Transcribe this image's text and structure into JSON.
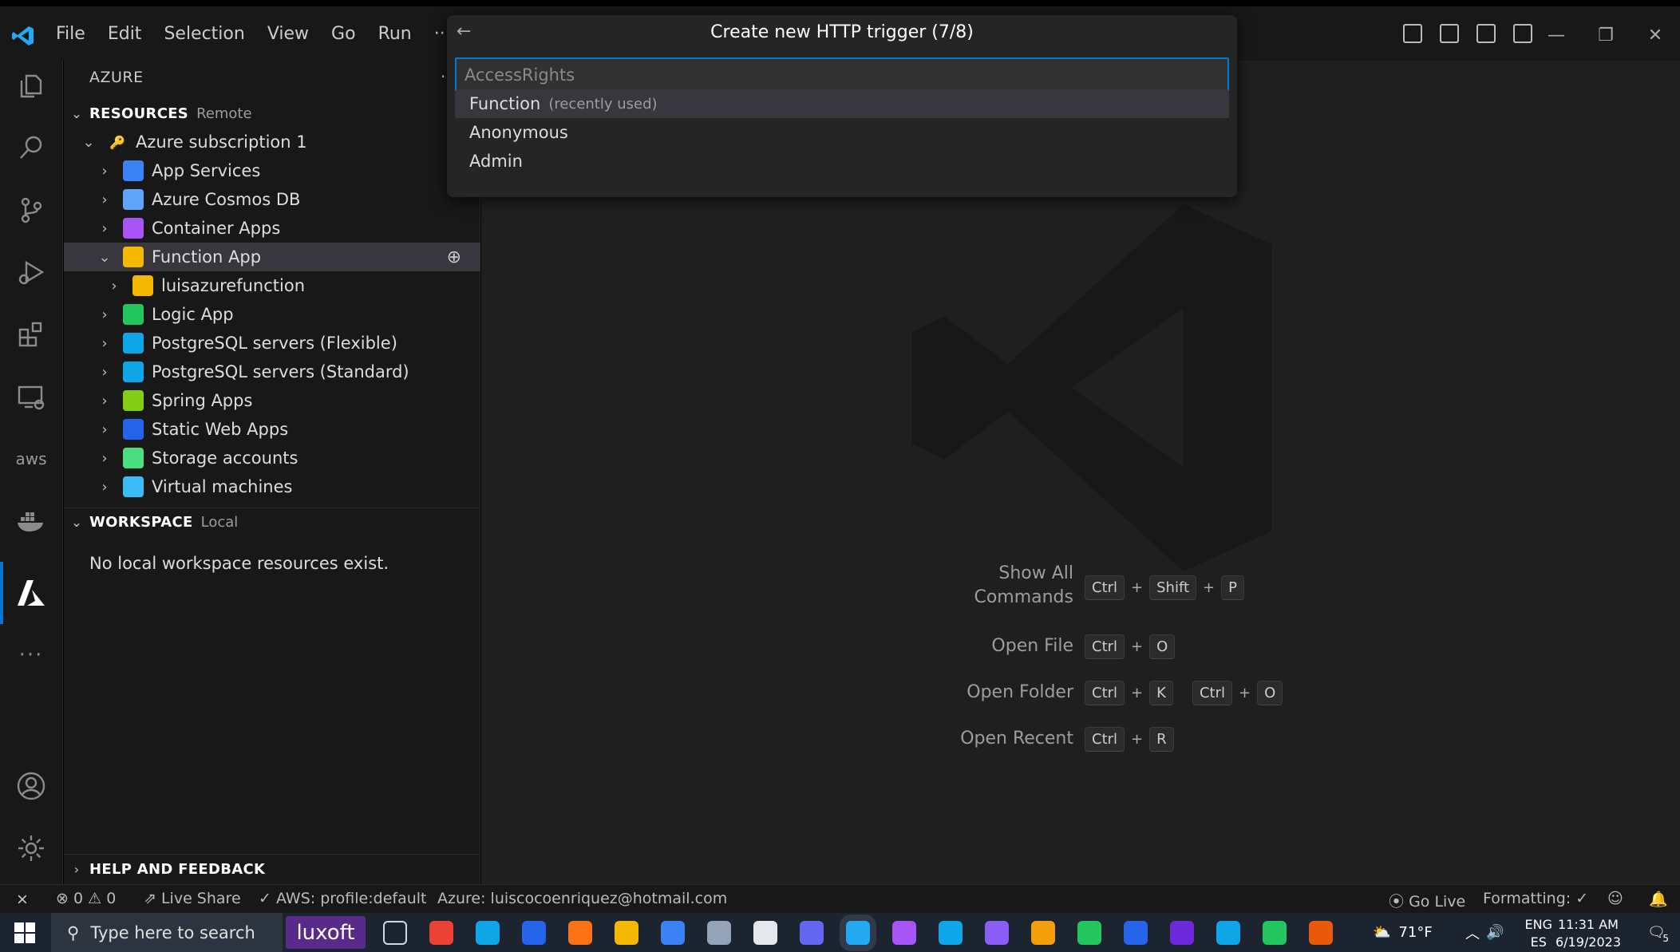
{
  "menu": [
    "File",
    "Edit",
    "Selection",
    "View",
    "Go",
    "Run",
    "···"
  ],
  "quickpick": {
    "title": "Create new HTTP trigger (7/8)",
    "placeholder": "AccessRights",
    "items": [
      {
        "label": "Function",
        "desc": "(recently used)"
      },
      {
        "label": "Anonymous",
        "desc": ""
      },
      {
        "label": "Admin",
        "desc": ""
      }
    ]
  },
  "sidebar": {
    "title": "AZURE",
    "resources": {
      "label": "RESOURCES",
      "sub": "Remote"
    },
    "subscription": "Azure subscription 1",
    "items": [
      {
        "label": "App Services",
        "icon": "app-services-icon",
        "color": "#3b82f6"
      },
      {
        "label": "Azure Cosmos DB",
        "icon": "cosmos-db-icon",
        "color": "#60a5fa"
      },
      {
        "label": "Container Apps",
        "icon": "container-apps-icon",
        "color": "#a855f7"
      },
      {
        "label": "Function App",
        "icon": "function-app-icon",
        "color": "#f5b700"
      },
      {
        "label": "luisazurefunction",
        "icon": "function-icon",
        "color": "#f5b700"
      },
      {
        "label": "Logic App",
        "icon": "logic-app-icon",
        "color": "#22c55e"
      },
      {
        "label": "PostgreSQL servers (Flexible)",
        "icon": "postgresql-icon",
        "color": "#0ea5e9"
      },
      {
        "label": "PostgreSQL servers (Standard)",
        "icon": "postgresql-icon",
        "color": "#0ea5e9"
      },
      {
        "label": "Spring Apps",
        "icon": "spring-apps-icon",
        "color": "#84cc16"
      },
      {
        "label": "Static Web Apps",
        "icon": "static-web-apps-icon",
        "color": "#2563eb"
      },
      {
        "label": "Storage accounts",
        "icon": "storage-icon",
        "color": "#4ade80"
      },
      {
        "label": "Virtual machines",
        "icon": "vm-icon",
        "color": "#38bdf8"
      }
    ],
    "workspace": {
      "label": "WORKSPACE",
      "sub": "Local",
      "empty": "No local workspace resources exist."
    },
    "help": "HELP AND FEEDBACK"
  },
  "shortcuts": [
    {
      "label": "Show All\nCommands",
      "keys": [
        [
          "Ctrl",
          "Shift",
          "P"
        ]
      ]
    },
    {
      "label": "Open File",
      "keys": [
        [
          "Ctrl",
          "O"
        ]
      ]
    },
    {
      "label": "Open Folder",
      "keys": [
        [
          "Ctrl",
          "K"
        ],
        [
          "Ctrl",
          "O"
        ]
      ]
    },
    {
      "label": "Open Recent",
      "keys": [
        [
          "Ctrl",
          "R"
        ]
      ]
    }
  ],
  "status": {
    "errors": "0",
    "warnings": "0",
    "liveshare": "Live Share",
    "aws": "AWS: profile:default",
    "azure": "Azure: luiscocoenriquez@hotmail.com",
    "golive": "Go Live",
    "formatting": "Formatting: ✓"
  },
  "taskbar": {
    "search_placeholder": "Type here to search",
    "luxoft": "luxoft",
    "weather": "71°F",
    "lang1": "ENG",
    "lang2": "ES",
    "time": "11:31 AM",
    "date": "6/19/2023",
    "notif": "5"
  },
  "colors": {
    "accent": "#0078d4",
    "bg": "#1f1f1f",
    "panel": "#181818"
  }
}
